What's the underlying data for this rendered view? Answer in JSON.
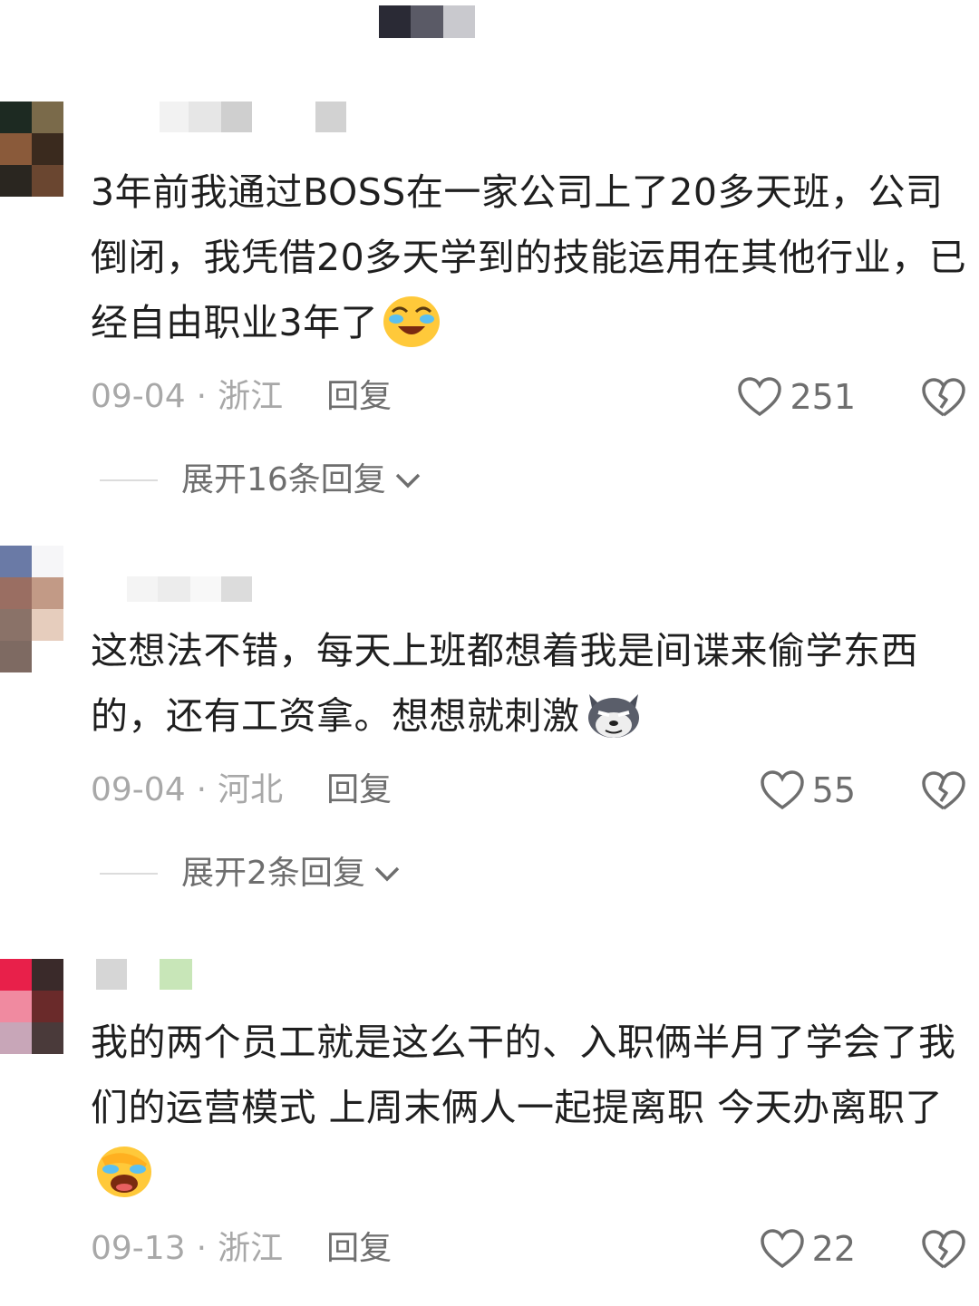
{
  "comments": [
    {
      "text": "3年前我通过BOSS在一家公司上了20多天班，公司倒闭，我凭借20多天学到的技能运用在其他行业，已经自由职业3年了",
      "emoji": "laugh-cry-emoji",
      "date": "09-04",
      "location": "浙江",
      "reply_label": "回复",
      "likes": "251",
      "expand_label": "展开16条回复"
    },
    {
      "text": "这想法不错，每天上班都想着我是间谍来偷学东西的，还有工资拿。想想就刺激",
      "emoji": "sly-dog-emoji",
      "date": "09-04",
      "location": "河北",
      "reply_label": "回复",
      "likes": "55",
      "expand_label": "展开2条回复"
    },
    {
      "text": "我的两个员工就是这么干的、入职俩半月了学会了我们的运营模式 上周末俩人一起提离职 今天办离职了",
      "emoji": "facepalm-laugh-emoji",
      "date": "09-13",
      "location": "浙江",
      "reply_label": "回复",
      "likes": "22"
    }
  ],
  "separator": "·",
  "colors": {
    "text": "#1f1f1f",
    "meta": "#a8a8a8",
    "action": "#6e6e6e"
  }
}
